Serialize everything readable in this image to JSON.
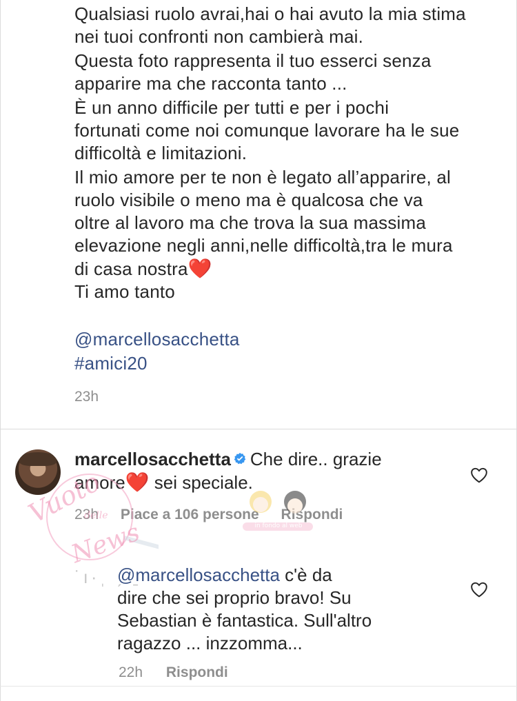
{
  "caption": {
    "lines": [
      "Qualsiasi ruolo avrai,hai o hai avuto la mia stima",
      "nei tuoi confronti non cambierà mai.",
      "Questa foto rappresenta il tuo esserci senza",
      "apparire ma che racconta tanto ...",
      "È un anno difficile per tutti e per i pochi",
      "fortunati come noi comunque lavorare ha le sue",
      "difficoltà e limitazioni.",
      "Il mio amore per te non è legato all’apparire, al",
      "ruolo visibile o meno ma è qualcosa che va",
      "oltre al lavoro ma che trova la sua massima",
      "elevazione negli anni,nelle difficoltà,tra le mura",
      "di casa nostra",
      "Ti amo tanto"
    ],
    "heart": "❤️",
    "mention": "@marcellosacchetta",
    "hashtag": "#amici20",
    "time": "23h"
  },
  "comment": {
    "username": "marcellosacchetta",
    "text_part1": "Che dire.. grazie",
    "text_part2": "amore",
    "heart": "❤️",
    "text_part3": " sei speciale.",
    "time": "23h",
    "likes": "Piace a 106 persone",
    "reply_label": "Rispondi"
  },
  "reply": {
    "mention": "@marcellosacchetta",
    "lines": [
      "c'è da",
      "dire che sei proprio bravo! Su",
      "Sebastian è fantastica. Sull'altro",
      "ragazzo ... inzzomma..."
    ],
    "time": "22h",
    "reply_label": "Rispondi"
  },
  "watermark": {
    "line1": "Vuoto",
    "line2": "delle",
    "line3": "News",
    "banner": "in fondo al web"
  },
  "colors": {
    "text": "#262626",
    "muted": "#8e8e8e",
    "link": "#385185",
    "heart": "#e0245e",
    "verified": "#3897f0",
    "divider": "#dbdbdb"
  }
}
